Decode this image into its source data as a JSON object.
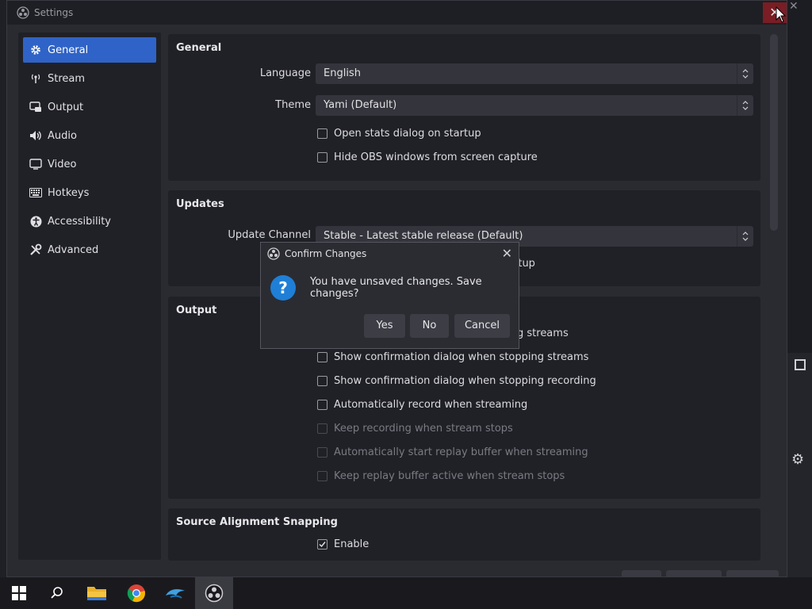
{
  "window": {
    "title": "Settings",
    "close_glyph": "✕"
  },
  "sidebar": {
    "items": [
      {
        "label": "General",
        "icon": "gear-icon"
      },
      {
        "label": "Stream",
        "icon": "broadcast-icon"
      },
      {
        "label": "Output",
        "icon": "output-icon"
      },
      {
        "label": "Audio",
        "icon": "speaker-icon"
      },
      {
        "label": "Video",
        "icon": "monitor-icon"
      },
      {
        "label": "Hotkeys",
        "icon": "keyboard-icon"
      },
      {
        "label": "Accessibility",
        "icon": "accessibility-icon"
      },
      {
        "label": "Advanced",
        "icon": "tools-icon"
      }
    ],
    "active_index": 0
  },
  "general": {
    "title": "General",
    "language_label": "Language",
    "language_value": "English",
    "theme_label": "Theme",
    "theme_value": "Yami (Default)",
    "open_stats": "Open stats dialog on startup",
    "hide_obs": "Hide OBS windows from screen capture"
  },
  "updates": {
    "title": "Updates",
    "channel_label": "Update Channel",
    "channel_value": "Stable - Latest stable release (Default)",
    "partial_text": "rtup"
  },
  "output": {
    "title": "Output",
    "partial_text": "g streams",
    "options": [
      {
        "label": "Show confirmation dialog when stopping streams",
        "disabled": false
      },
      {
        "label": "Show confirmation dialog when stopping recording",
        "disabled": false
      },
      {
        "label": "Automatically record when streaming",
        "disabled": false
      },
      {
        "label": "Keep recording when stream stops",
        "disabled": true
      },
      {
        "label": "Automatically start replay buffer when streaming",
        "disabled": true
      },
      {
        "label": "Keep replay buffer active when stream stops",
        "disabled": true
      }
    ]
  },
  "snapping": {
    "title": "Source Alignment Snapping",
    "enable_label": "Enable",
    "enable_checked": true
  },
  "dialog": {
    "title": "Confirm Changes",
    "close_glyph": "✕",
    "question_glyph": "?",
    "message": "You have unsaved changes. Save changes?",
    "yes": "Yes",
    "no": "No",
    "cancel": "Cancel"
  },
  "taskbar": {
    "items": [
      "windows-start-icon",
      "search-icon",
      "file-explorer-icon",
      "chrome-icon",
      "dolphin-icon",
      "obs-icon"
    ]
  },
  "colors": {
    "accent": "#2f63c7",
    "dialog_icon": "#1f7fd6",
    "close_hover": "#7a1d24"
  }
}
